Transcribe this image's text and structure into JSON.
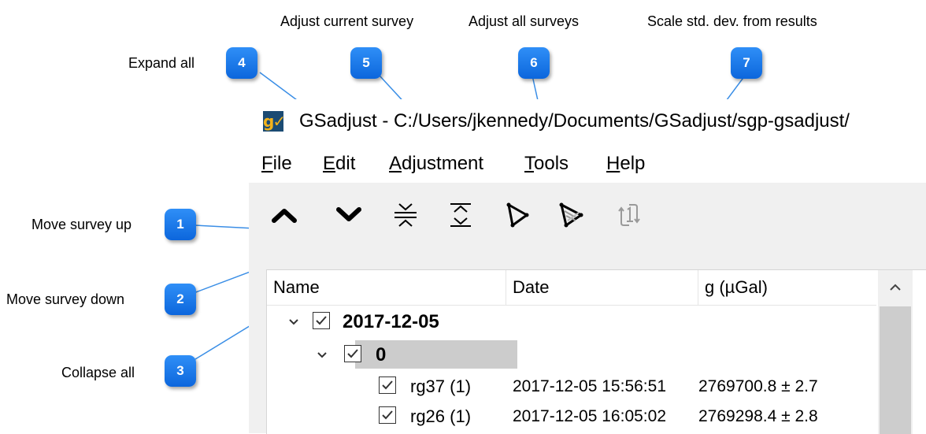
{
  "callouts": [
    {
      "number": "1",
      "label": "Move survey up"
    },
    {
      "number": "2",
      "label": "Move survey down"
    },
    {
      "number": "3",
      "label": "Collapse all"
    },
    {
      "number": "4",
      "label": "Expand all"
    },
    {
      "number": "5",
      "label": "Adjust current survey"
    },
    {
      "number": "6",
      "label": "Adjust all surveys"
    },
    {
      "number": "7",
      "label": "Scale std. dev. from results"
    }
  ],
  "window": {
    "logo_text": "g✓",
    "title": "GSadjust - C:/Users/jkennedy/Documents/GSadjust/sgp-gsadjust/"
  },
  "menu": [
    "File",
    "Edit",
    "Adjustment",
    "Tools",
    "Help"
  ],
  "toolbar_icons": [
    "move-up-icon",
    "move-down-icon",
    "collapse-all-icon",
    "expand-all-icon",
    "adjust-current-survey-icon",
    "adjust-all-surveys-icon",
    "scale-std-dev-icon"
  ],
  "tree": {
    "columns": [
      "Name",
      "Date",
      "g (µGal)"
    ],
    "rows": [
      {
        "level": 0,
        "expanded": true,
        "checked": true,
        "bold": true,
        "name": "2017-12-05",
        "date": "",
        "g": ""
      },
      {
        "level": 1,
        "expanded": true,
        "checked": true,
        "bold": true,
        "selected": true,
        "name": "0",
        "date": "",
        "g": ""
      },
      {
        "level": 2,
        "checked": true,
        "bold": false,
        "name": "rg37 (1)",
        "date": "2017-12-05 15:56:51",
        "g": "2769700.8 ± 2.7"
      },
      {
        "level": 2,
        "checked": true,
        "bold": false,
        "name": "rg26 (1)",
        "date": "2017-12-05 16:05:02",
        "g": "2769298.4 ± 2.8"
      }
    ]
  },
  "colors": {
    "badge": "#1a73e8",
    "leader_line": "#3a8ee6",
    "selection": "#cccccc",
    "logo_bg": "#1b4b73",
    "logo_fg": "#f2b21b"
  }
}
